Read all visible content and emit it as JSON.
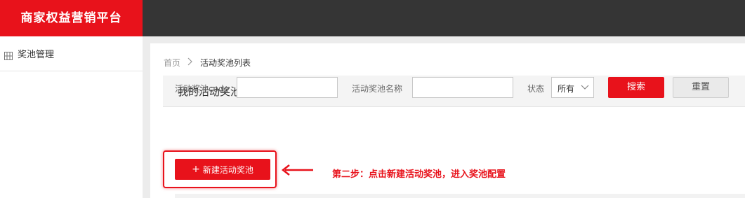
{
  "header": {
    "brand": "商家权益营销平台"
  },
  "sidebar": {
    "items": [
      {
        "label": "奖池管理",
        "icon": "grid-icon"
      }
    ]
  },
  "breadcrumb": {
    "home": "首页",
    "current": "活动奖池列表"
  },
  "panel": {
    "title": "我的活动奖池"
  },
  "filters": {
    "code_label": "活动奖池code",
    "code_value": "",
    "name_label": "活动奖池名称",
    "name_value": "",
    "status_label": "状态",
    "status_value": "所有"
  },
  "buttons": {
    "search": "搜索",
    "reset": "重置",
    "new_plus": "+",
    "new_label": "新建活动奖池"
  },
  "annotation": {
    "text": "第二步：点击新建活动奖池，进入奖池配置"
  },
  "colors": {
    "brand": "#e8121b",
    "topbar": "#353535",
    "annotation": "#e8121b"
  }
}
